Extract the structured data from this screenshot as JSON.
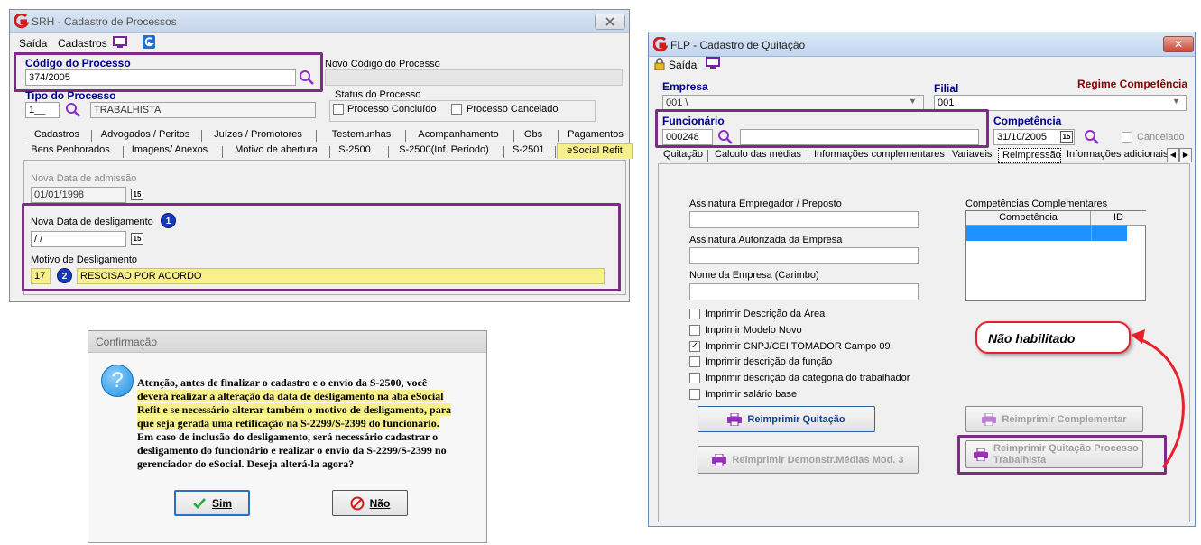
{
  "srh": {
    "title": "SRH - Cadastro de Processos",
    "menu": {
      "saida": "Saída",
      "cadastros": "Cadastros"
    },
    "codigo_label": "Código do Processo",
    "codigo_value": "374/2005",
    "novo_codigo_label": "Novo Código do Processo",
    "tipo_label": "Tipo do Processo",
    "tipo_code": "1__",
    "tipo_desc": "TRABALHISTA",
    "status_label": "Status do Processo",
    "status_concluido": "Processo Concluído",
    "status_cancelado": "Processo Cancelado",
    "tabs_row1": [
      "Cadastros",
      "Advogados / Peritos",
      "Juízes / Promotores",
      "Testemunhas",
      "Acompanhamento",
      "Obs",
      "Pagamentos"
    ],
    "tabs_row2": [
      "Bens Penhorados",
      "Imagens/ Anexos",
      "Motivo de abertura",
      "S-2500",
      "S-2500(Inf. Período)",
      "S-2501",
      "eSocial Refit"
    ],
    "nova_admissao_label": "Nova Data de admissão",
    "nova_admissao_value": "01/01/1998",
    "nova_deslig_label": "Nova Data de desligamento",
    "nova_deslig_value": " /  /",
    "motivo_label": "Motivo de Desligamento",
    "motivo_code": "17",
    "motivo_desc": "RESCISAO POR ACORDO",
    "badge1": "1",
    "badge2": "2"
  },
  "confirm": {
    "title": "Confirmação",
    "icon_glyph": "?",
    "line1": "Atenção, antes de finalizar o cadastro e o envio da S-2500, você",
    "line2": "deverá realizar a alteração da data de desligamento na aba eSocial",
    "line3": "Refit  e se necessário alterar também o motivo de desligamento, para",
    "line4": "que seja gerada uma retificação na S-2299/S-2399 do funcionário.",
    "line5": "Em caso de inclusão do desligamento, será necessário cadastrar o",
    "line6": "desligamento do funcionário e realizar o envio da S-2299/S-2399 no",
    "line7": "gerenciador do eSocial. Deseja alterá-la agora?",
    "sim_label": "Sim",
    "nao_label": "Não"
  },
  "flp": {
    "title": "FLP - Cadastro de Quitação",
    "close_glyph": "✕",
    "menu_saida": "Saída",
    "empresa_label": "Empresa",
    "empresa_value": "001 \\",
    "filial_label": "Filial",
    "filial_value": "001",
    "regime_label": "Regime Competência",
    "funcionario_label": "Funcionário",
    "funcionario_value": "000248",
    "competencia_label": "Competência",
    "competencia_value": "31/10/2005",
    "cancelado_label": "Cancelado",
    "tabs": [
      "Quitação",
      "Calculo das médias",
      "Informações complementares",
      "Variaveis",
      "Reimpressão",
      "Informações adicionais"
    ],
    "tab_prev": "◀",
    "tab_next": "▶",
    "assinatura_empregador_label": "Assinatura Empregador / Preposto",
    "assinatura_autorizada_label": "Assinatura Autorizada da Empresa",
    "nome_empresa_label": "Nome da Empresa (Carimbo)",
    "checkboxes": [
      {
        "label": "Imprimir Descrição da Área",
        "checked": false
      },
      {
        "label": "Imprimir Modelo Novo",
        "checked": false
      },
      {
        "label": "Imprimir CNPJ/CEI TOMADOR Campo 09",
        "checked": true
      },
      {
        "label": "Imprimir descrição da função",
        "checked": false
      },
      {
        "label": "Imprimir descrição da categoria do trabalhador",
        "checked": false
      },
      {
        "label": "Imprimir salário base",
        "checked": false
      }
    ],
    "competencias_label": "Competências Complementares",
    "col_competencia": "Competência",
    "col_id": "ID",
    "btn_reimprimir_quitacao": "Reimprimir Quitação",
    "btn_reimprimir_complementar": "Reimprimir Complementar",
    "btn_reimprimir_demonstr": "Reimprimir Demonstr.Médias Mod. 3",
    "btn_reimprimir_processo_1": "Reimprimir Quitação Processo",
    "btn_reimprimir_processo_2": "Trabalhista",
    "callout_text": "Não habilitado"
  },
  "colors": {
    "highlight_border": "#7b2d85",
    "label_blue": "#00008b",
    "regime_red": "#8b0000",
    "yellow_field": "#f8f08a",
    "selection_blue": "#1e90ff",
    "callout_red": "#e8202a"
  }
}
